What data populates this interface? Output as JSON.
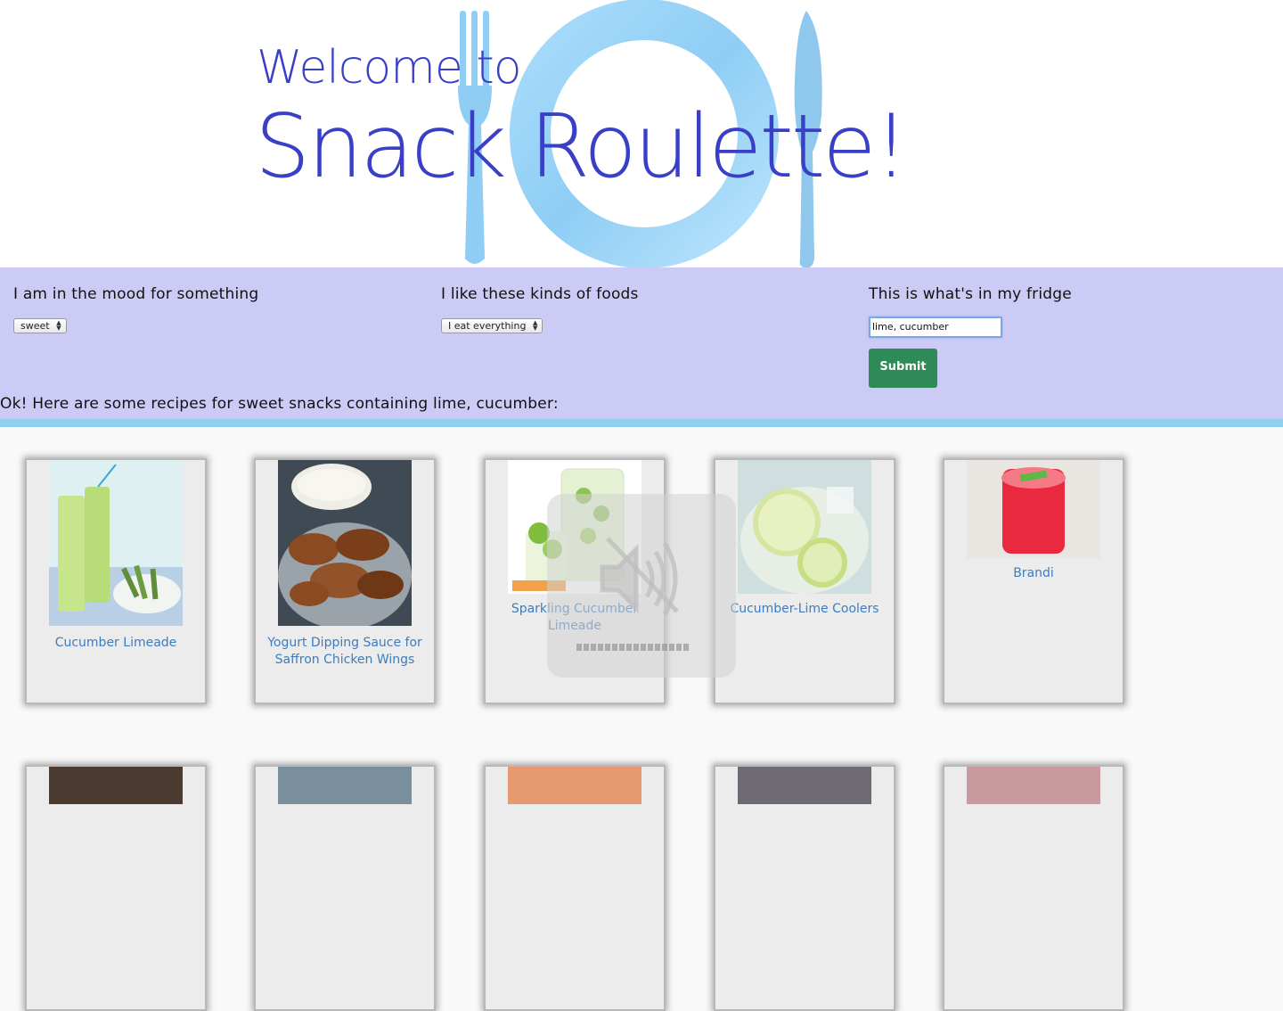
{
  "header": {
    "welcome": "Welcome to",
    "title": "Snack Roulette!"
  },
  "form": {
    "mood": {
      "label": "I am in the mood for something",
      "selected": "sweet"
    },
    "foods": {
      "label": "I like these kinds of foods",
      "selected": "I eat everything"
    },
    "fridge": {
      "label": "This is what's in my fridge",
      "value": "lime, cucumber"
    },
    "submit_label": "Submit"
  },
  "result_text": "Ok! Here are some recipes for sweet snacks containing lime, cucumber:",
  "recipes": [
    {
      "name": "Cucumber Limeade"
    },
    {
      "name": "Yogurt Dipping Sauce for Saffron Chicken Wings"
    },
    {
      "name": "Sparkling Cucumber Limeade"
    },
    {
      "name": "Cucumber-Lime Coolers"
    },
    {
      "name": "Brandi"
    }
  ],
  "colors": {
    "title": "#3a3fc8",
    "band": "#cbcbf5",
    "divider": "#8fd0ec",
    "submit": "#2e8b57",
    "link": "#3d7dbf"
  },
  "icons": [
    "fork-icon",
    "plate-icon",
    "knife-icon",
    "volume-muted-icon"
  ]
}
